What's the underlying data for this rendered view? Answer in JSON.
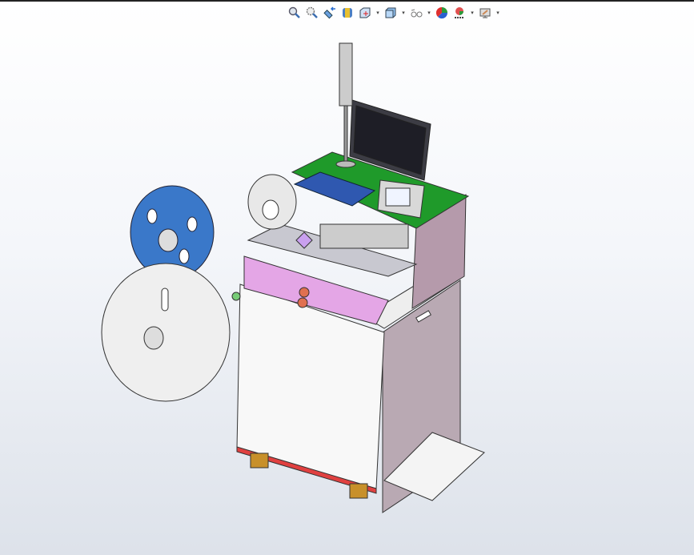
{
  "toolbar": {
    "items": [
      {
        "icon": "zoom-to-fit-icon",
        "dropdown": false
      },
      {
        "icon": "zoom-to-area-icon",
        "dropdown": false
      },
      {
        "icon": "previous-view-icon",
        "dropdown": false
      },
      {
        "icon": "section-view-icon",
        "dropdown": false
      },
      {
        "icon": "view-orientation-icon",
        "dropdown": true
      },
      {
        "icon": "display-style-icon",
        "dropdown": true
      },
      {
        "icon": "hide-show-items-icon",
        "dropdown": true
      },
      {
        "icon": "edit-appearance-icon",
        "dropdown": false
      },
      {
        "icon": "apply-scene-icon",
        "dropdown": true
      },
      {
        "icon": "view-settings-icon",
        "dropdown": true
      }
    ]
  },
  "colors": {
    "reel_blue": "#3a78c9",
    "deck_green": "#1f9a2a",
    "panel_pink": "#e4a6e6",
    "cabinet_gray": "#b9a9b3"
  }
}
